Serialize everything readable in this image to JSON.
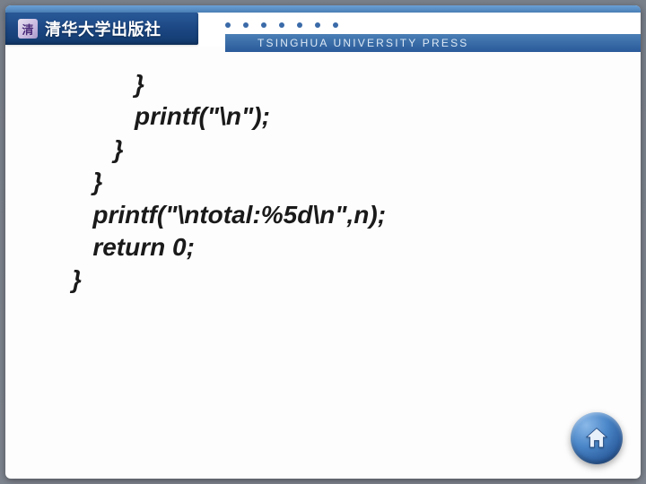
{
  "header": {
    "publisher_zh": "清华大学出版社",
    "publisher_en": "TSINGHUA UNIVERSITY PRESS",
    "logo_glyph": "清"
  },
  "code_lines": [
    "         }",
    "         printf(\"\\n\");",
    "      }",
    "   }",
    "   printf(\"\\ntotal:%5d\\n\",n);",
    "   return 0;",
    "}"
  ],
  "nav": {
    "home_label": "home"
  }
}
